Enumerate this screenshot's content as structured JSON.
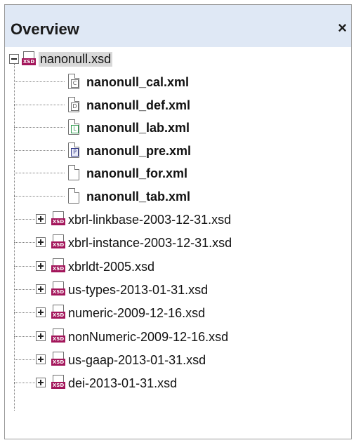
{
  "panel": {
    "title": "Overview",
    "close_glyph": "×"
  },
  "root": {
    "label": "nanonull.xsd",
    "icon": "xsd-file-icon",
    "expanded": true
  },
  "linkbases": [
    {
      "label": "nanonull_cal.xml",
      "icon_letter": "C"
    },
    {
      "label": "nanonull_def.xml",
      "icon_letter": "D"
    },
    {
      "label": "nanonull_lab.xml",
      "icon_letter": "L"
    },
    {
      "label": "nanonull_pre.xml",
      "icon_letter": "P"
    },
    {
      "label": "nanonull_for.xml",
      "icon_letter": ""
    },
    {
      "label": "nanonull_tab.xml",
      "icon_letter": ""
    }
  ],
  "imports": [
    {
      "label": "xbrl-linkbase-2003-12-31.xsd"
    },
    {
      "label": "xbrl-instance-2003-12-31.xsd"
    },
    {
      "label": "xbrldt-2005.xsd"
    },
    {
      "label": "us-types-2013-01-31.xsd"
    },
    {
      "label": "numeric-2009-12-16.xsd"
    },
    {
      "label": "nonNumeric-2009-12-16.xsd"
    },
    {
      "label": "us-gaap-2013-01-31.xsd"
    },
    {
      "label": "dei-2013-01-31.xsd"
    }
  ],
  "xsd_badge": "XSD",
  "colors": {
    "header_bg": "#dfe8f5",
    "xsd_badge": "#a3165b",
    "selection_bg": "#d8d8d8"
  }
}
